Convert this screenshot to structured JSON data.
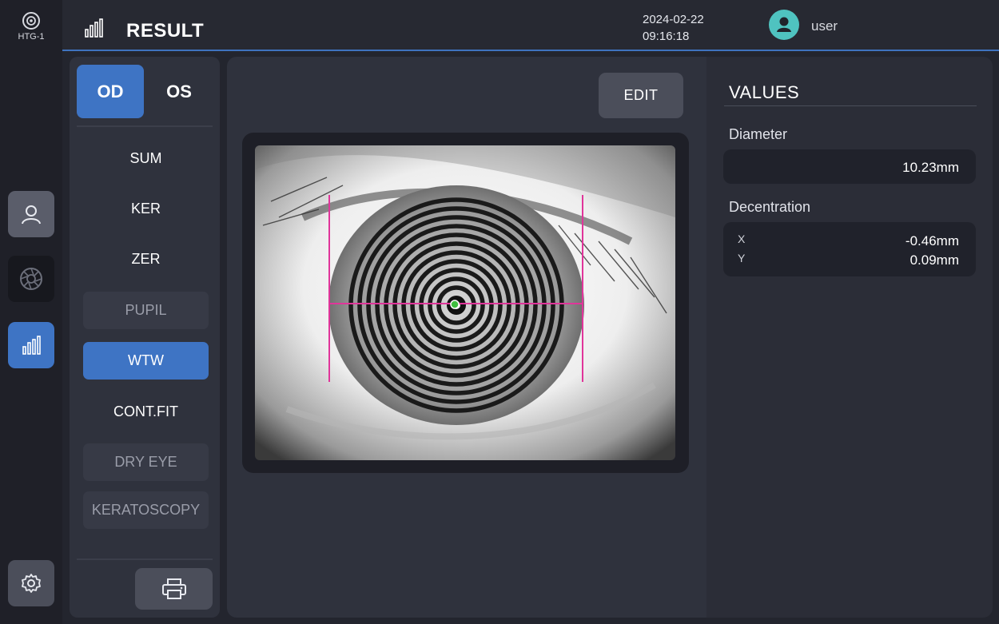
{
  "app": {
    "logo_text": "HTG-1",
    "logo_icon": "device-logo-icon"
  },
  "rail": {
    "items": [
      {
        "icon": "user-icon"
      },
      {
        "icon": "aperture-icon"
      },
      {
        "icon": "bar-chart-icon"
      },
      {
        "icon": "gear-icon"
      }
    ]
  },
  "header": {
    "title": "RESULT",
    "title_icon": "bar-chart-icon",
    "date": "2024-02-22",
    "time": "09:16:18",
    "user": "user",
    "avatar_color": "#4fc3c0"
  },
  "eye_tabs": {
    "od": "OD",
    "os": "OS",
    "selected": "OD"
  },
  "menu": {
    "items": [
      {
        "label": "SUM",
        "state": "normal"
      },
      {
        "label": "KER",
        "state": "normal"
      },
      {
        "label": "ZER",
        "state": "normal"
      },
      {
        "label": "PUPIL",
        "state": "disabled"
      },
      {
        "label": "WTW",
        "state": "active"
      },
      {
        "label": "CONT.FIT",
        "state": "normal"
      },
      {
        "label": "DRY EYE",
        "state": "disabled"
      },
      {
        "label": "KERATOSCOPY",
        "state": "disabled"
      }
    ],
    "print_icon": "printer-icon"
  },
  "main": {
    "edit_label": "EDIT",
    "image_icon": "placido-eye-image"
  },
  "values": {
    "title": "VALUES",
    "diameter_label": "Diameter",
    "diameter_value": "10.23mm",
    "decentration_label": "Decentration",
    "x_label": "X",
    "x_value": "-0.46mm",
    "y_label": "Y",
    "y_value": "0.09mm"
  },
  "colors": {
    "accent": "#3e74c4",
    "measure_line": "#e0359a",
    "center_marker": "#3fbf3f"
  }
}
